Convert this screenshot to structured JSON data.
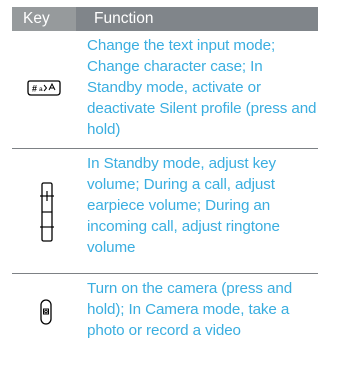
{
  "table": {
    "headers": {
      "key": "Key",
      "function": "Function"
    },
    "rows": [
      {
        "icon": "hash-key-icon",
        "function": "Change the text input mode; Change character case; In Standby mode, activate or deactivate Silent profile (press and hold)"
      },
      {
        "icon": "volume-key-icon",
        "function": "In Standby mode, adjust key volume; During a call, adjust earpiece volume; During an incoming call, adjust ringtone volume"
      },
      {
        "icon": "camera-key-icon",
        "function": "Turn on the camera (press and hold); In Camera mode, take a photo or record a video"
      }
    ]
  },
  "colors": {
    "header_bg": "#80858a",
    "text_accent": "#3aaee0",
    "divider": "#7d8185"
  }
}
